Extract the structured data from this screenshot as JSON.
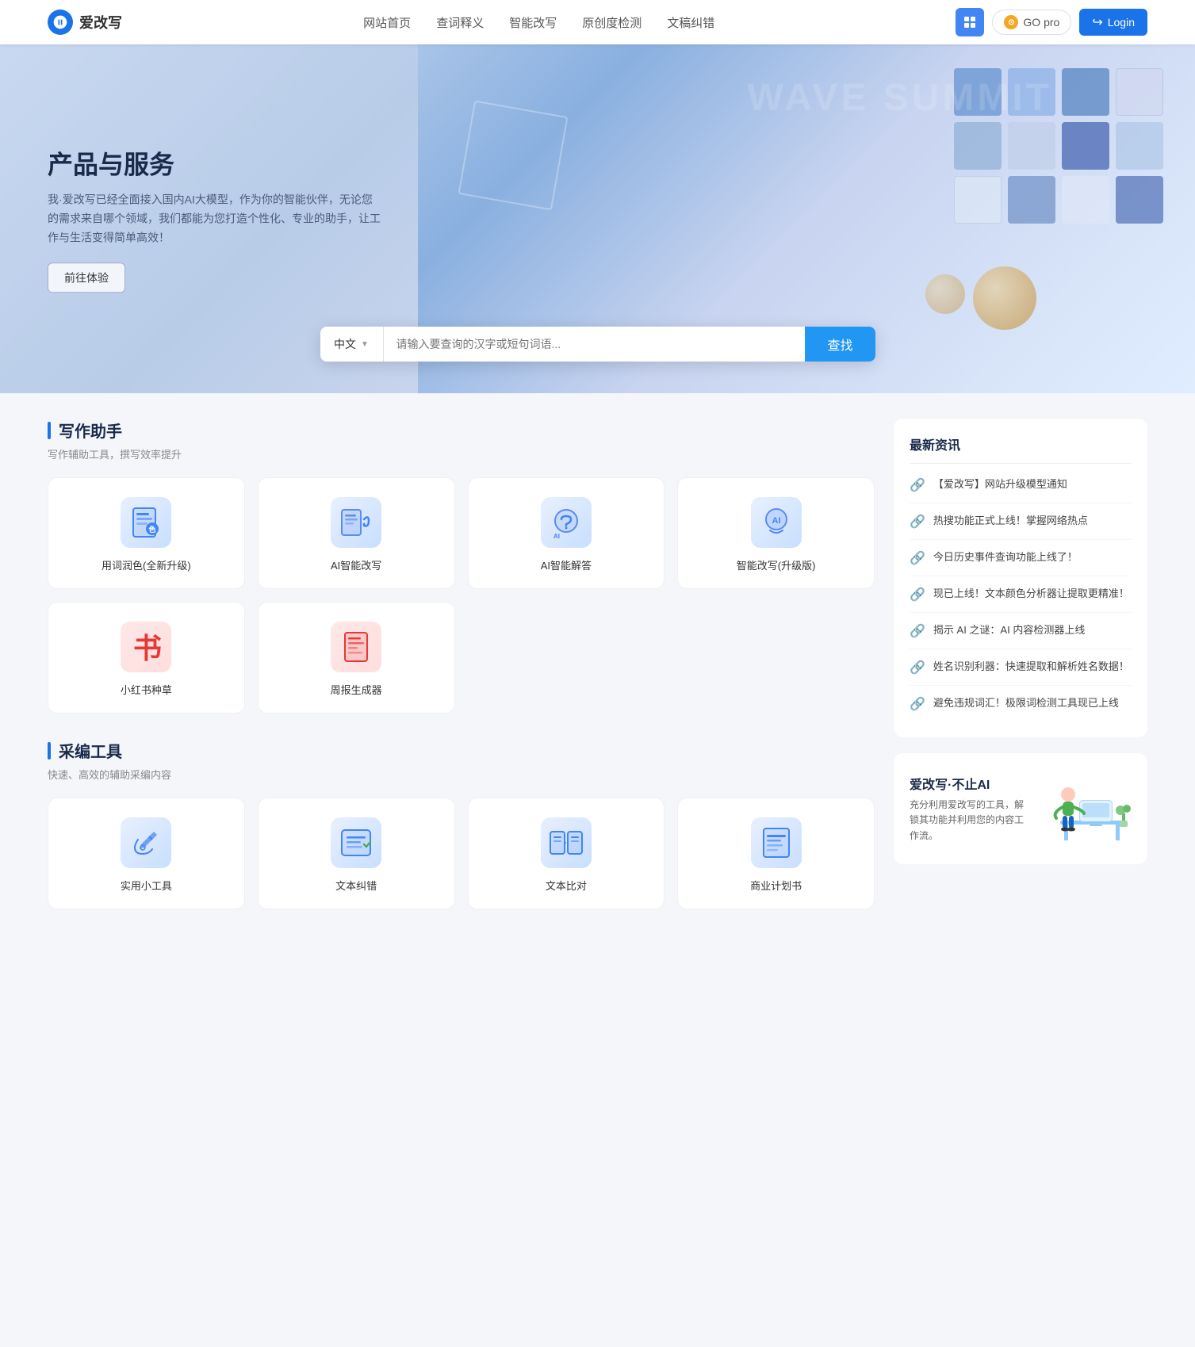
{
  "site": {
    "name": "爱改写",
    "logo_alt": "爱改写 logo"
  },
  "nav": {
    "links": [
      {
        "label": "网站首页",
        "href": "#"
      },
      {
        "label": "查词释义",
        "href": "#"
      },
      {
        "label": "智能改写",
        "href": "#"
      },
      {
        "label": "原创度检测",
        "href": "#"
      },
      {
        "label": "文稿纠错",
        "href": "#"
      }
    ],
    "btn_grid_label": "grid",
    "btn_go_label": "GO pro",
    "btn_login_label": "Login"
  },
  "hero": {
    "title": "产品与服务",
    "desc": "我·爱改写已经全面接入国内AI大模型，作为你的智能伙伴，无论您的需求来自哪个领域，我们都能为您打造个性化、专业的助手，让工作与生活变得简单高效！",
    "btn_label": "前往体验",
    "search": {
      "lang": "中文",
      "placeholder": "请输入要查询的汉字或短句词语...",
      "btn_label": "查找"
    }
  },
  "writing_section": {
    "title": "写作助手",
    "subtitle": "写作辅助工具，撰写效率提升",
    "tools": [
      {
        "id": "word-color",
        "label": "用词润色(全新升级)",
        "icon": "doc-edit"
      },
      {
        "id": "ai-rewrite",
        "label": "AI智能改写",
        "icon": "ai-rewrite"
      },
      {
        "id": "ai-answer",
        "label": "AI智能解答",
        "icon": "ai-answer"
      },
      {
        "id": "smart-rewrite",
        "label": "智能改写(升级版)",
        "icon": "smart-rewrite"
      },
      {
        "id": "xiaohongshu",
        "label": "小红书种草",
        "icon": "book-red"
      },
      {
        "id": "weekly-report",
        "label": "周报生成器",
        "icon": "doc-red"
      }
    ]
  },
  "editing_section": {
    "title": "采编工具",
    "subtitle": "快速、高效的辅助采编内容",
    "tools": [
      {
        "id": "practical",
        "label": "实用小工具",
        "icon": "wrench"
      },
      {
        "id": "text-correct",
        "label": "文本纠错",
        "icon": "text-correct"
      },
      {
        "id": "text-compare",
        "label": "文本比对",
        "icon": "text-compare"
      },
      {
        "id": "business-plan",
        "label": "商业计划书",
        "icon": "business"
      }
    ]
  },
  "news": {
    "title": "最新资讯",
    "items": [
      {
        "text": "【爱改写】网站升级模型通知"
      },
      {
        "text": "热搜功能正式上线！掌握网络热点"
      },
      {
        "text": "今日历史事件查询功能上线了！"
      },
      {
        "text": "现已上线！文本颜色分析器让提取更精准！"
      },
      {
        "text": "揭示 AI 之谜：AI 内容检测器上线"
      },
      {
        "text": "姓名识别利器：快速提取和解析姓名数据！"
      },
      {
        "text": "避免违规词汇！极限词检测工具现已上线"
      }
    ]
  },
  "ad": {
    "title": "爱改写·不止AI",
    "desc": "充分利用爱改写的工具，解锁其功能并利用您的内容工作流。"
  }
}
